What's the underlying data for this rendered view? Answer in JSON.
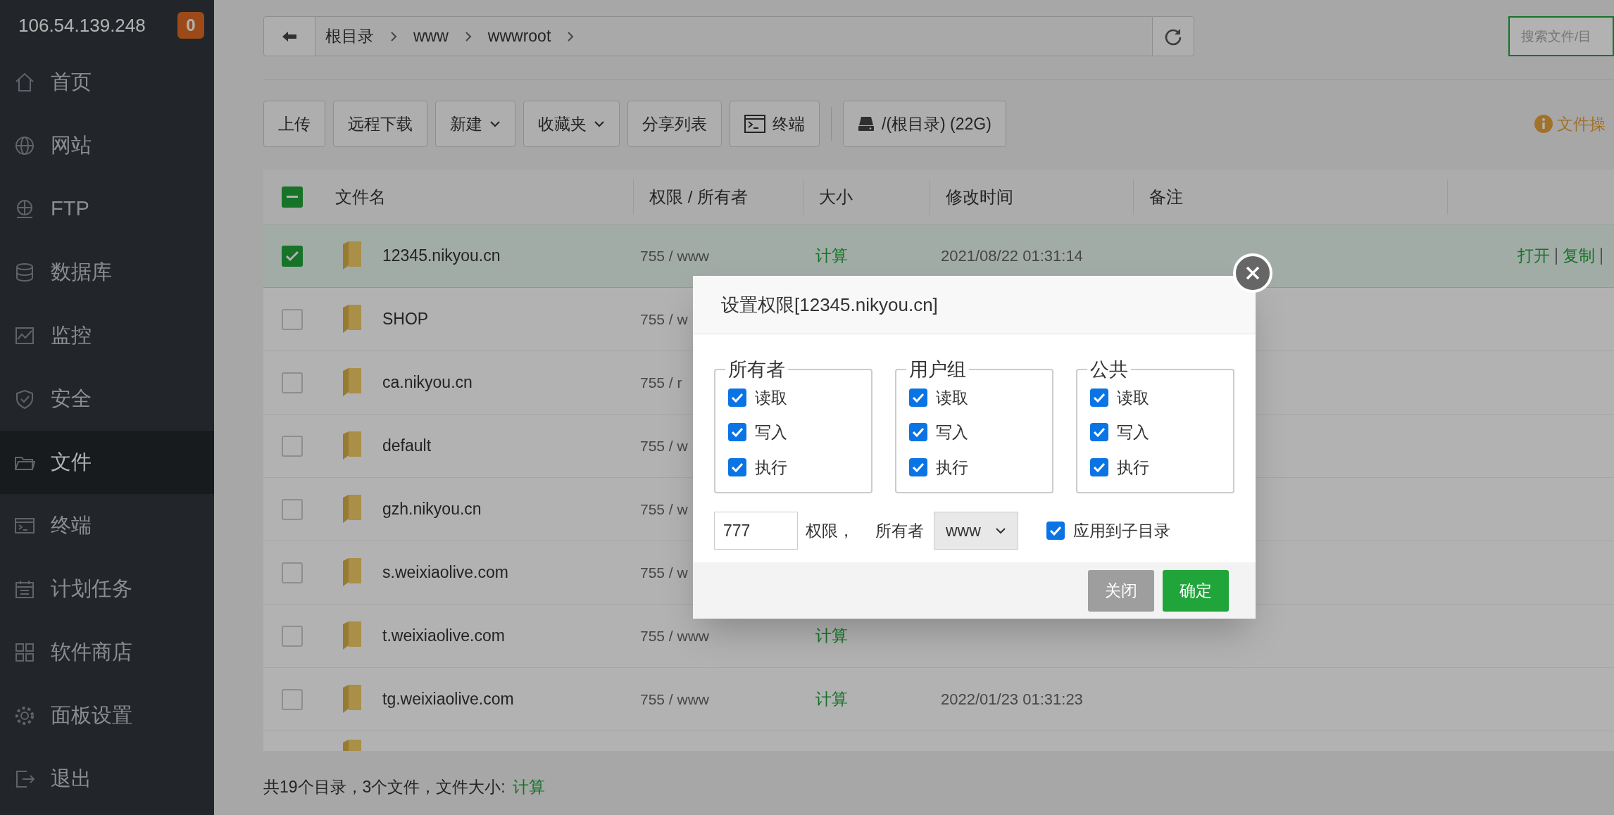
{
  "sidebar": {
    "host": "106.54.139.248",
    "badge": "0",
    "items": [
      {
        "label": "首页",
        "selected": false
      },
      {
        "label": "网站",
        "selected": false
      },
      {
        "label": "FTP",
        "selected": false
      },
      {
        "label": "数据库",
        "selected": false
      },
      {
        "label": "监控",
        "selected": false
      },
      {
        "label": "安全",
        "selected": false
      },
      {
        "label": "文件",
        "selected": true
      },
      {
        "label": "终端",
        "selected": false
      },
      {
        "label": "计划任务",
        "selected": false
      },
      {
        "label": "软件商店",
        "selected": false
      },
      {
        "label": "面板设置",
        "selected": false
      },
      {
        "label": "退出",
        "selected": false
      }
    ]
  },
  "breadcrumb": [
    "根目录",
    "www",
    "wwwroot"
  ],
  "search": {
    "placeholder": "搜索文件/目"
  },
  "toolbar": [
    {
      "label": "上传",
      "kind": "plain"
    },
    {
      "label": "远程下载",
      "kind": "plain"
    },
    {
      "label": "新建",
      "kind": "dropdown"
    },
    {
      "label": "收藏夹",
      "kind": "dropdown"
    },
    {
      "label": "分享列表",
      "kind": "plain"
    },
    {
      "label": "终端",
      "kind": "terminal"
    },
    {
      "label": "/(根目录) (22G)",
      "kind": "disk"
    }
  ],
  "notice": "文件操",
  "table": {
    "select_all_indeterminate": true,
    "columns": [
      "文件名",
      "权限 / 所有者",
      "大小",
      "修改时间",
      "备注"
    ],
    "rows": [
      {
        "name": "12345.nikyou.cn",
        "perms": "755 / www",
        "size": "计算",
        "modified": "2021/08/22 01:31:14",
        "selected": true,
        "actions": [
          "打开",
          "复制"
        ]
      },
      {
        "name": "SHOP",
        "perms": "755 / w",
        "selected": false
      },
      {
        "name": "ca.nikyou.cn",
        "perms": "755 / r",
        "selected": false
      },
      {
        "name": "default",
        "perms": "755 / w",
        "selected": false
      },
      {
        "name": "gzh.nikyou.cn",
        "perms": "755 / w",
        "selected": false
      },
      {
        "name": "s.weixiaolive.com",
        "perms": "755 / w",
        "selected": false
      },
      {
        "name": "t.weixiaolive.com",
        "perms": "755 / www",
        "size": "计算",
        "selected": false
      },
      {
        "name": "tg.weixiaolive.com",
        "perms": "755 / www",
        "size": "计算",
        "modified": "2022/01/23 01:31:23",
        "selected": false
      }
    ]
  },
  "footer": {
    "summary": "共19个目录，3个文件，文件大小:",
    "link": "计算"
  },
  "dialog": {
    "title": "设置权限[12345.nikyou.cn]",
    "groups": [
      {
        "label": "所有者",
        "options": [
          {
            "label": "读取",
            "checked": true
          },
          {
            "label": "写入",
            "checked": true
          },
          {
            "label": "执行",
            "checked": true
          }
        ]
      },
      {
        "label": "用户组",
        "options": [
          {
            "label": "读取",
            "checked": true
          },
          {
            "label": "写入",
            "checked": true
          },
          {
            "label": "执行",
            "checked": true
          }
        ]
      },
      {
        "label": "公共",
        "options": [
          {
            "label": "读取",
            "checked": true
          },
          {
            "label": "写入",
            "checked": true
          },
          {
            "label": "执行",
            "checked": true
          }
        ]
      }
    ],
    "mode_value": "777",
    "mode_label": "权限，",
    "owner_label": "所有者",
    "owner_value": "www",
    "recursive": {
      "label": "应用到子目录",
      "checked": true
    },
    "buttons": [
      {
        "label": "关闭",
        "kind": "secondary"
      },
      {
        "label": "确定",
        "kind": "primary"
      }
    ]
  }
}
